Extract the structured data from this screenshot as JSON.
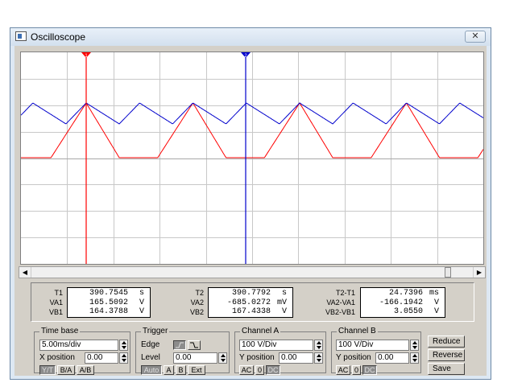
{
  "window": {
    "title": "Oscilloscope",
    "close_glyph": "✕"
  },
  "scroll": {
    "left_glyph": "◀",
    "right_glyph": "▶"
  },
  "cursors": {
    "t1_label": "1",
    "t2_label": "2"
  },
  "readout": {
    "t1": {
      "label_t": "T1",
      "label_va": "VA1",
      "label_vb": "VB1",
      "t": "390.7545",
      "t_unit": "s",
      "va": "165.5092",
      "va_unit": "V",
      "vb": "164.3788",
      "vb_unit": "V"
    },
    "t2": {
      "label_t": "T2",
      "label_va": "VA2",
      "label_vb": "VB2",
      "t": "390.7792",
      "t_unit": "s",
      "va": "-685.0272",
      "va_unit": "mV",
      "vb": "167.4338",
      "vb_unit": "V"
    },
    "diff": {
      "label_t": "T2-T1",
      "label_va": "VA2-VA1",
      "label_vb": "VB2-VB1",
      "t": "24.7396",
      "t_unit": "ms",
      "va": "-166.1942",
      "va_unit": "V",
      "vb": "3.0550",
      "vb_unit": "V"
    }
  },
  "timebase": {
    "title": "Time base",
    "value": "5.00ms/div",
    "xpos_label": "X position",
    "xpos_value": "0.00",
    "yt": "Y/T",
    "ba": "B/A",
    "ab": "A/B"
  },
  "trigger": {
    "title": "Trigger",
    "edge_label": "Edge",
    "level_label": "Level",
    "level_value": "0.00",
    "auto": "Auto",
    "a": "A",
    "b": "B",
    "ext": "Ext"
  },
  "channel_a": {
    "title": "Channel A",
    "value": "100 V/Div",
    "ypos_label": "Y position",
    "ypos_value": "0.00",
    "ac": "AC",
    "zero": "0",
    "dc": "DC"
  },
  "channel_b": {
    "title": "Channel B",
    "value": "100 V/Div",
    "ypos_label": "Y position",
    "ypos_value": "0.00",
    "ac": "AC",
    "zero": "0",
    "dc": "DC"
  },
  "buttons": {
    "reduce": "Reduce",
    "reverse": "Reverse",
    "save": "Save"
  },
  "colors": {
    "channel_a": "#ff0000",
    "channel_b": "#0000cc",
    "grid": "#c8c8c8"
  }
}
